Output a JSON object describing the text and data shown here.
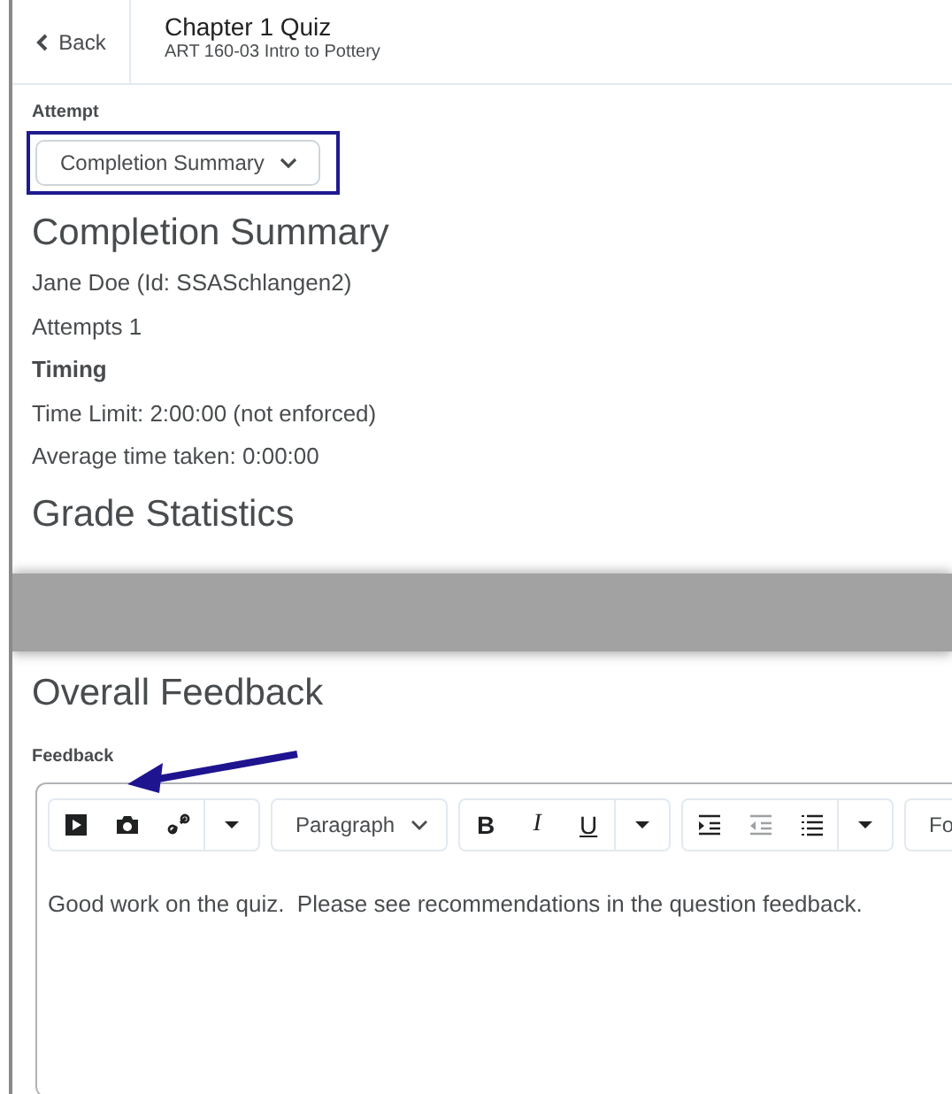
{
  "header": {
    "back": "Back",
    "title": "Chapter 1 Quiz",
    "subtitle": "ART 160-03 Intro to Pottery"
  },
  "attempt": {
    "label": "Attempt",
    "value": "Completion Summary"
  },
  "summary": {
    "heading": "Completion Summary",
    "lines": [
      {
        "text": "Jane Doe (Id: SSASchlangen2)",
        "bold": false
      },
      {
        "text": "Attempts 1",
        "bold": false
      },
      {
        "text": "Timing",
        "bold": true
      },
      {
        "text": "Time Limit: 2:00:00 (not enforced)",
        "bold": false
      },
      {
        "text": "Average time taken: 0:00:00",
        "bold": false
      }
    ]
  },
  "grade_heading": "Grade Statistics",
  "feedback": {
    "heading": "Overall Feedback",
    "label": "Feedback",
    "toolbar": [
      [
        {
          "kind": "video"
        },
        {
          "kind": "camera"
        },
        {
          "kind": "link"
        },
        {
          "kind": "caret"
        }
      ],
      [
        {
          "kind": "select",
          "text": "Paragraph"
        }
      ],
      [
        {
          "kind": "bold",
          "text": "B"
        },
        {
          "kind": "italic",
          "text": "I"
        },
        {
          "kind": "underline",
          "text": "U"
        },
        {
          "kind": "caret"
        }
      ],
      [
        {
          "kind": "indent"
        },
        {
          "kind": "outdent"
        },
        {
          "kind": "list"
        },
        {
          "kind": "caret"
        }
      ],
      [
        {
          "kind": "cut",
          "text": "Fo"
        }
      ]
    ],
    "text": "Good work on the quiz.  Please see recommendations in the question feedback."
  }
}
